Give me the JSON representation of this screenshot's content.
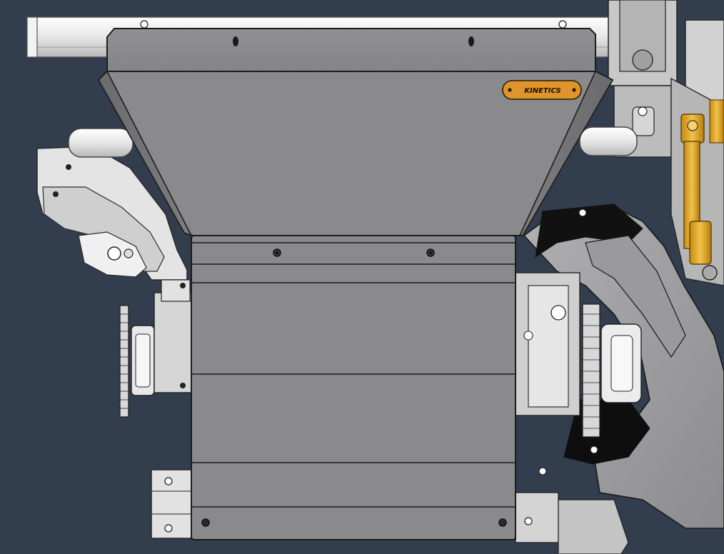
{
  "scene": {
    "background_color": "#323d4e",
    "plate_color": "#8a8a8c",
    "plate_edge_color": "#1c1c1c",
    "frame_color": "#dcdcdc",
    "accent_color": "#e2a32a",
    "badge_color": "#e0952c",
    "badge_text": "KINETICS"
  }
}
